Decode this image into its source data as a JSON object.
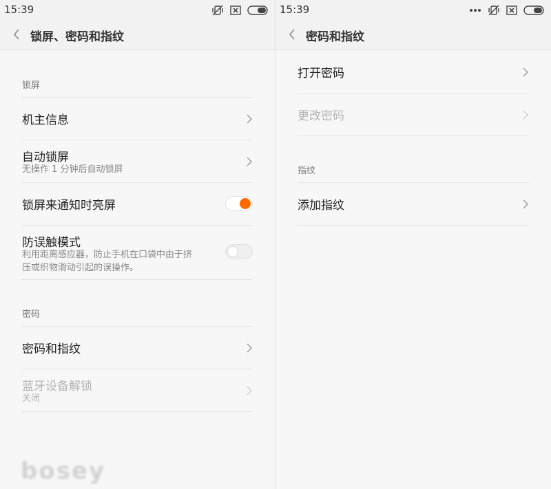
{
  "colors": {
    "accent": "#ff6a00",
    "background": "#f7f7f7",
    "disabled_text": "#b5b5b5"
  },
  "left": {
    "status": {
      "time": "15:39",
      "icons": [
        "vibrate-off-icon",
        "no-sim-icon",
        "battery-icon"
      ]
    },
    "title": "锁屏、密码和指纹",
    "sections": {
      "lock": "锁屏",
      "password": "密码"
    },
    "items": {
      "owner_info": {
        "title": "机主信息"
      },
      "auto_lock": {
        "title": "自动锁屏",
        "subtitle": "无操作 1 分钟后自动锁屏"
      },
      "wake_on_notify": {
        "title": "锁屏来通知时亮屏",
        "toggle": "on"
      },
      "anti_mistouch": {
        "title": "防误触模式",
        "subtitle_line1": "利用距离感应器，防止手机在口袋中由于挤",
        "subtitle_line2": "压或织物滑动引起的误操作。",
        "toggle": "off"
      },
      "password_fingerprint": {
        "title": "密码和指纹"
      },
      "bluetooth_unlock": {
        "title": "蓝牙设备解锁",
        "subtitle": "关闭"
      }
    },
    "watermark": "bosey"
  },
  "right": {
    "status": {
      "time": "15:39",
      "icons": [
        "more-dots-icon",
        "vibrate-off-icon",
        "no-sim-icon",
        "battery-icon"
      ]
    },
    "title": "密码和指纹",
    "sections": {
      "fingerprint": "指纹"
    },
    "items": {
      "turn_on_password": {
        "title": "打开密码"
      },
      "change_password": {
        "title": "更改密码"
      },
      "add_fingerprint": {
        "title": "添加指纹"
      }
    }
  }
}
